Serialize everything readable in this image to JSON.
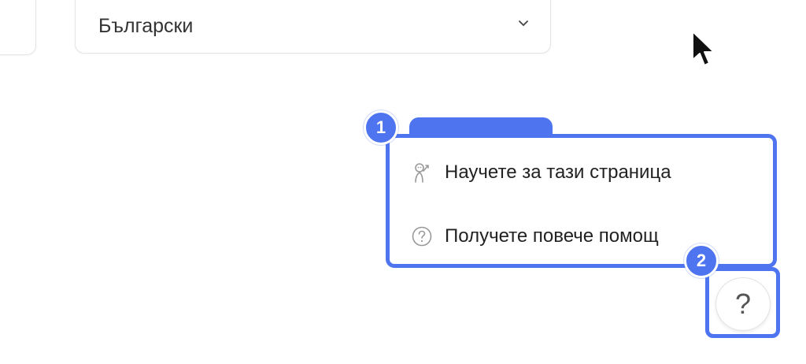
{
  "language_select": {
    "label": "",
    "value": "Български"
  },
  "help_menu": {
    "items": [
      {
        "label": "Научете за тази страница",
        "icon": "tour-person-icon"
      },
      {
        "label": "Получете повече помощ",
        "icon": "question-circle-icon"
      }
    ]
  },
  "annotations": {
    "badge_1": "1",
    "badge_2": "2"
  },
  "help_button": {
    "glyph": "?",
    "icon": "help-icon"
  },
  "colors": {
    "highlight": "#4f74f0",
    "text": "#222222",
    "border": "#e4e4e4"
  }
}
